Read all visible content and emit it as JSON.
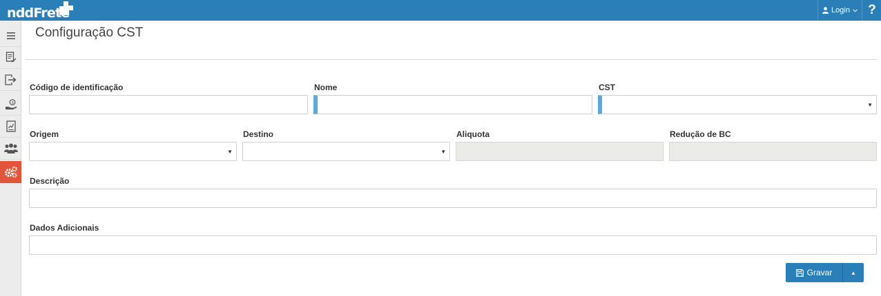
{
  "app": {
    "logo_text": "nddFrete",
    "login_label": "Login",
    "help_label": "?"
  },
  "colors": {
    "brand": "#2a7fb8",
    "active_sidebar": "#e2553a",
    "required_marker": "#5aa8dc",
    "readonly_bg": "#ebebe7"
  },
  "sidebar": {
    "items": [
      {
        "icon": "menu-icon"
      },
      {
        "icon": "document-check-icon"
      },
      {
        "icon": "export-icon"
      },
      {
        "icon": "hand-coin-icon"
      },
      {
        "icon": "report-icon"
      },
      {
        "icon": "users-icon"
      },
      {
        "icon": "gears-icon",
        "active": true
      }
    ]
  },
  "page": {
    "title": "Configuração CST"
  },
  "form": {
    "codigo": {
      "label": "Código de identificação",
      "value": ""
    },
    "nome": {
      "label": "Nome",
      "value": ""
    },
    "cst": {
      "label": "CST",
      "value": ""
    },
    "origem": {
      "label": "Origem",
      "value": ""
    },
    "destino": {
      "label": "Destino",
      "value": ""
    },
    "aliquota": {
      "label": "Aliquota",
      "value": ""
    },
    "reducao": {
      "label": "Redução de BC",
      "value": ""
    },
    "descricao": {
      "label": "Descrição",
      "value": ""
    },
    "dados": {
      "label": "Dados Adicionais",
      "value": ""
    }
  },
  "actions": {
    "save_label": "Gravar"
  }
}
